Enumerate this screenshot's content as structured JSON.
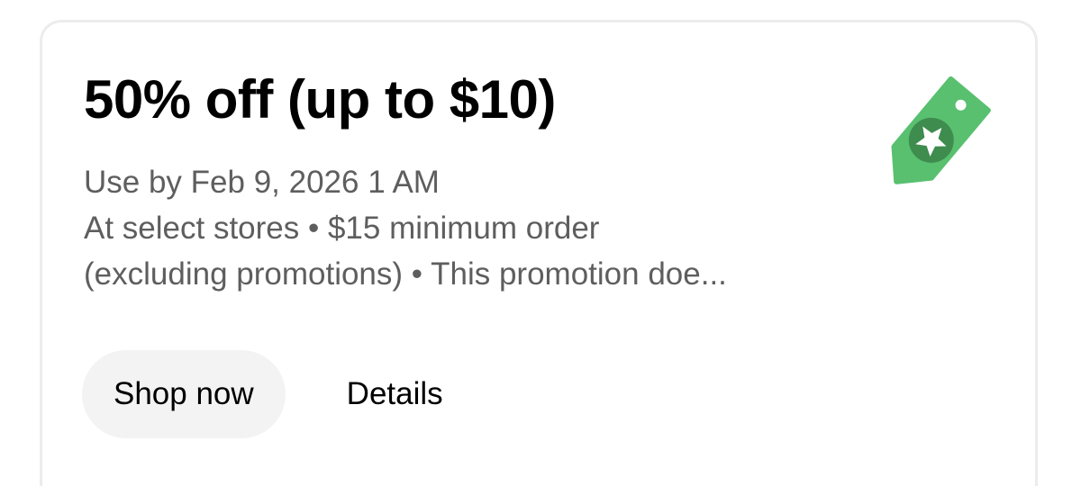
{
  "offer": {
    "title": "50% off (up to $10)",
    "description": [
      "Use by Feb 9, 2026 1 AM",
      "At select stores • $15 minimum order",
      "(excluding promotions) • This promotion doe..."
    ],
    "icon": "price-tag-star-icon"
  },
  "actions": {
    "shop_label": "Shop now",
    "details_label": "Details"
  },
  "colors": {
    "tag_green": "#58c06f",
    "tag_dark_green": "#3e8c4e",
    "text_primary": "#000000",
    "text_secondary": "#5e5e5e",
    "button_bg": "#f3f3f3",
    "card_border": "#ececec"
  }
}
